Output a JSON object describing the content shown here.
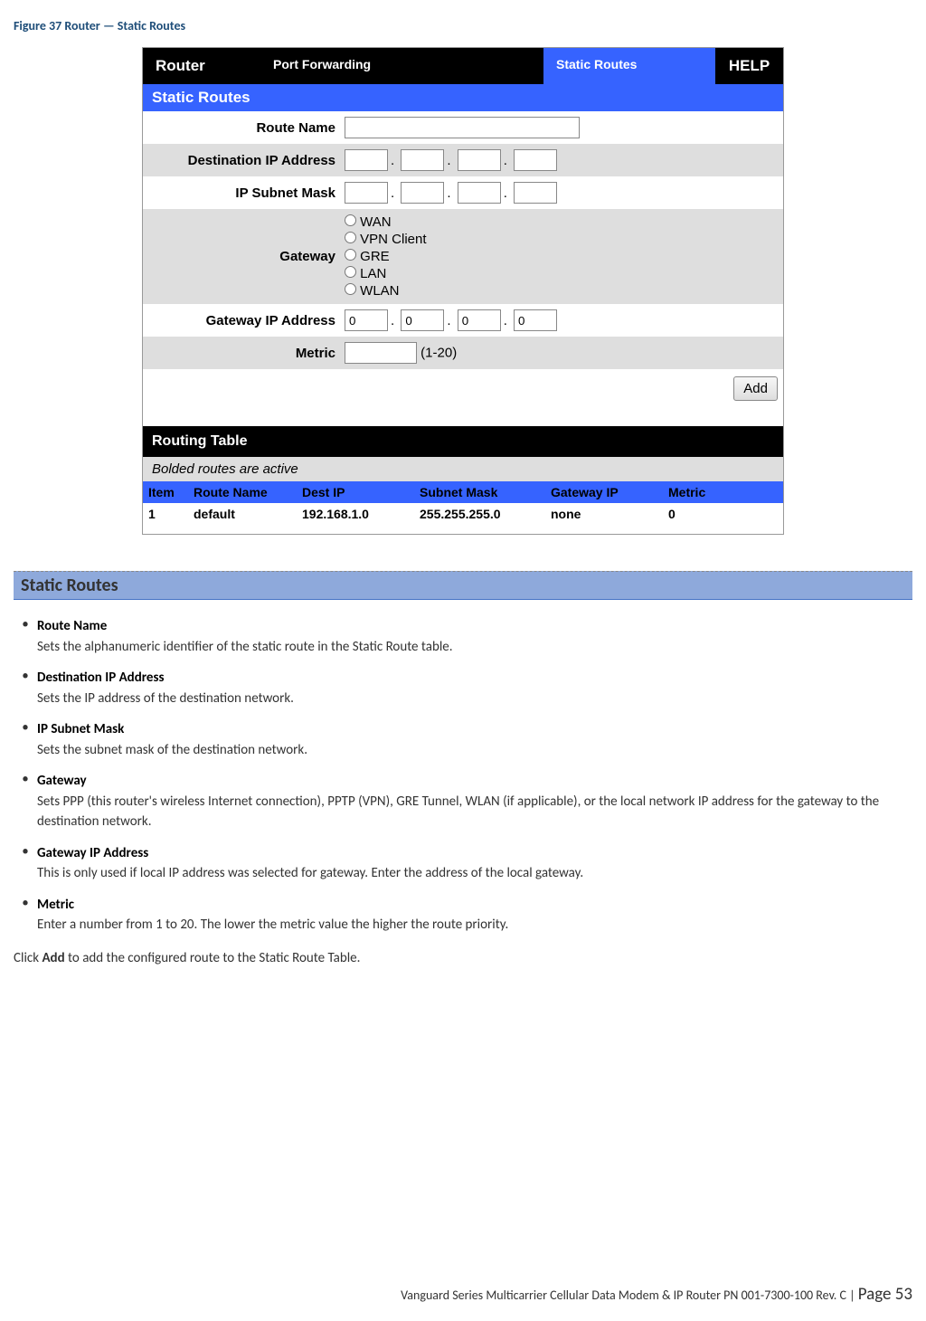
{
  "figure_caption": "Figure 37 Router — Static Routes",
  "nav": {
    "router": "Router",
    "portfwd": "Port Forwarding",
    "static": "Static Routes",
    "help": "HELP"
  },
  "section_bar": "Static Routes",
  "form": {
    "route_name_label": "Route Name",
    "dest_ip_label": "Destination IP Address",
    "subnet_label": "IP Subnet Mask",
    "gateway_label": "Gateway",
    "gateway_opts": {
      "wan": "WAN",
      "vpn": "VPN Client",
      "gre": "GRE",
      "lan": "LAN",
      "wlan": "WLAN"
    },
    "gw_ip_label": "Gateway IP Address",
    "gw_ip": [
      "0",
      "0",
      "0",
      "0"
    ],
    "metric_label": "Metric",
    "metric_hint": "(1-20)",
    "add_btn": "Add"
  },
  "routing_table": {
    "title": "Routing Table",
    "note": "Bolded routes are active",
    "headers": {
      "item": "Item",
      "name": "Route Name",
      "dest": "Dest IP",
      "mask": "Subnet Mask",
      "gw": "Gateway IP",
      "metric": "Metric"
    },
    "row1": {
      "item": "1",
      "name": "default",
      "dest": "192.168.1.0",
      "mask": "255.255.255.0",
      "gw": "none",
      "metric": "0"
    }
  },
  "desc_heading": "Static Routes",
  "bullets": {
    "b1_title": "Route Name",
    "b1_text": "Sets the alphanumeric identifier of the static route in the Static Route table.",
    "b2_title": "Destination IP Address",
    "b2_text": "Sets the IP address of the destination network.",
    "b3_title": "IP Subnet Mask",
    "b3_text": "Sets the subnet mask of the destination network.",
    "b4_title": "Gateway",
    "b4_text": "Sets PPP (this router's wireless Internet connection), PPTP (VPN), GRE Tunnel, WLAN (if applicable), or the local network IP address for the gateway to the destination network.",
    "b5_title": "Gateway IP Address",
    "b5_text": "This is only used if local IP address was selected for gateway. Enter the address of the local gateway.",
    "b6_title": "Metric",
    "b6_text": "Enter a number from 1 to 20. The lower the metric value the higher the route priority."
  },
  "after_text_pre": "Click ",
  "after_text_bold": "Add",
  "after_text_post": " to add the configured route to the Static Route Table.",
  "footer": {
    "doc": "Vanguard Series Multicarrier Cellular Data Modem & IP Router PN 001-7300-100 Rev. C",
    "sep": " | ",
    "page": "Page 53"
  }
}
